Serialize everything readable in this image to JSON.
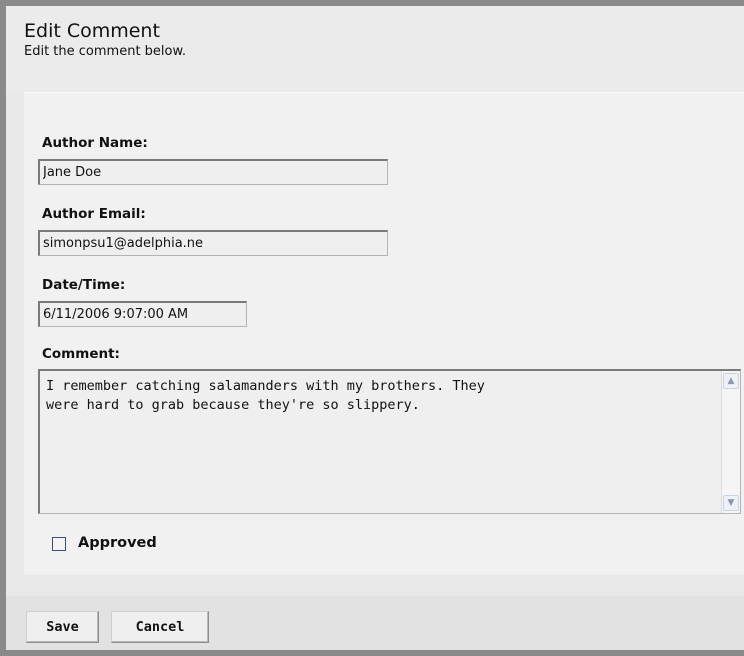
{
  "header": {
    "title": "Edit Comment",
    "subtitle": "Edit the comment below."
  },
  "form": {
    "author_name_label": "Author Name:",
    "author_name_value": "Jane Doe",
    "author_email_label": "Author Email:",
    "author_email_value": "simonpsu1@adelphia.ne",
    "datetime_label": "Date/Time:",
    "datetime_value": "6/11/2006 9:07:00 AM",
    "comment_label": "Comment:",
    "comment_value": "I remember catching salamanders with my brothers. They\nwere hard to grab because they're so slippery.",
    "approved_label": "Approved",
    "approved_checked": false
  },
  "actions": {
    "save_label": "Save",
    "cancel_label": "Cancel"
  },
  "icons": {
    "scroll_up": "scroll-up-arrow-icon",
    "scroll_down": "scroll-down-arrow-icon",
    "checkbox": "checkbox-icon"
  }
}
